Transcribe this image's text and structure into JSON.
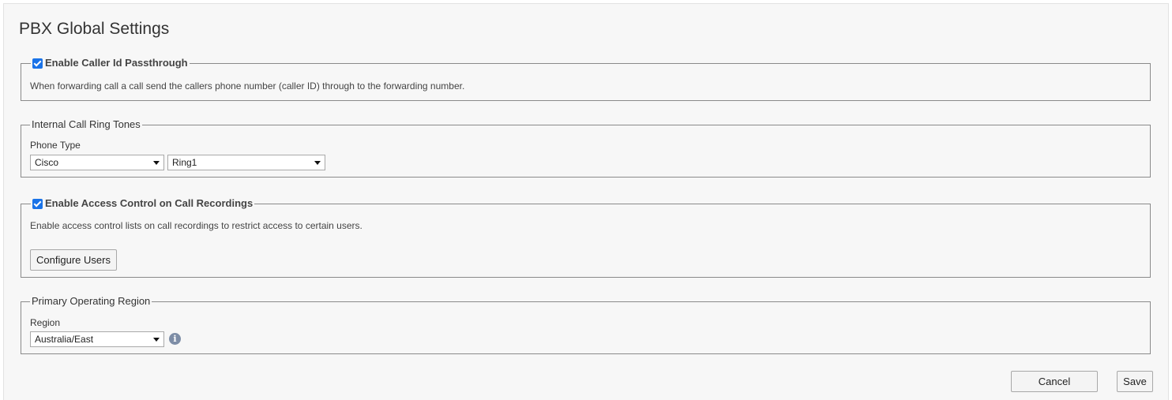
{
  "page": {
    "title": "PBX Global Settings"
  },
  "caller_id": {
    "legend": "Enable Caller Id Passthrough",
    "checked": true,
    "description": "When forwarding call a call send the callers phone number (caller ID) through to the forwarding number."
  },
  "ring_tones": {
    "legend": "Internal Call Ring Tones",
    "phone_type_label": "Phone Type",
    "phone_type_value": "Cisco",
    "ring_value": "Ring1"
  },
  "access_control": {
    "legend": "Enable Access Control on Call Recordings",
    "checked": true,
    "description": "Enable access control lists on call recordings to restrict access to certain users.",
    "configure_button": "Configure Users"
  },
  "region": {
    "legend": "Primary Operating Region",
    "region_label": "Region",
    "region_value": "Australia/East",
    "info_icon": "info-icon"
  },
  "footer": {
    "cancel_label": "Cancel",
    "save_label": "Save"
  },
  "colors": {
    "accent": "#1a73e8",
    "panel_bg": "#f7f7f7",
    "border": "#8a8a8a"
  }
}
